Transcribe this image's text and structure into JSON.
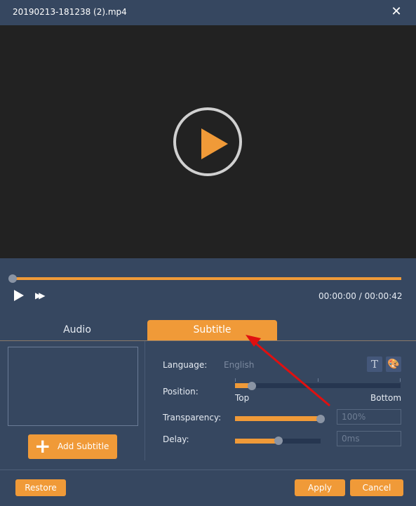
{
  "window": {
    "title": "20190213-181238 (2).mp4",
    "close_icon": "close-icon"
  },
  "player": {
    "current_time": "00:00:00",
    "separator": "/",
    "total_time": "00:00:42",
    "progress": 0
  },
  "tabs": [
    {
      "label": "Audio",
      "active": false
    },
    {
      "label": "Subtitle",
      "active": true
    }
  ],
  "subtitle": {
    "add_label": "Add Subtitle",
    "language_label": "Language:",
    "language_value": "English",
    "position_label": "Position:",
    "position_top": "Top",
    "position_bottom": "Bottom",
    "position_value": 0.04,
    "transparency_label": "Transparency:",
    "transparency_value": "100%",
    "delay_label": "Delay:",
    "delay_value": "0ms",
    "delay_fraction": 0.5
  },
  "footer": {
    "restore": "Restore",
    "apply": "Apply",
    "cancel": "Cancel"
  },
  "colors": {
    "accent": "#f09a38",
    "background": "#364760",
    "video": "#222222",
    "annotation": "#e01010"
  }
}
